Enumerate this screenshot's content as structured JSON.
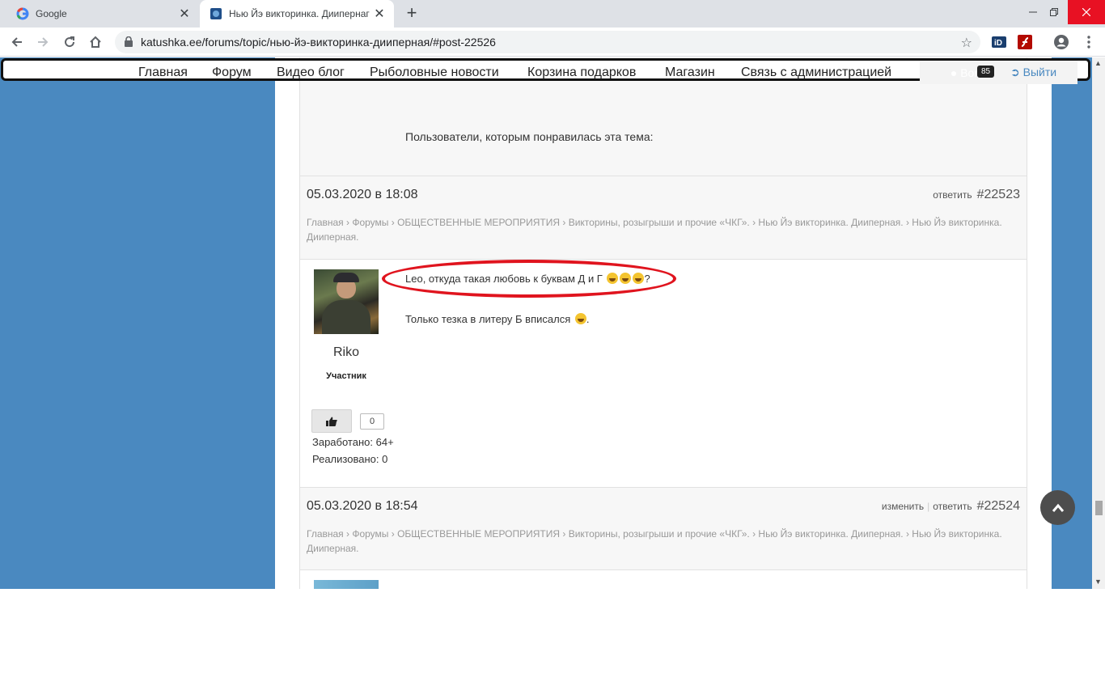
{
  "browser": {
    "tabs": [
      {
        "title": "Google",
        "icon": "google-g-icon"
      },
      {
        "title": "Нью Йэ викторинка. Диипернаг",
        "icon": "site-favicon"
      }
    ],
    "url": "katushka.ee/forums/topic/нью-йэ-викторинка-дииперная/#post-22526",
    "new_tab_symbol": "+",
    "close_symbol": "✕"
  },
  "nav": {
    "items": [
      "Главная",
      "Форум",
      "Видео блог",
      "Рыболовные новости",
      "Корзина подарков",
      "Магазин",
      "Связь с администрацией"
    ],
    "user": "Boris",
    "badge": "85",
    "logout": "Выйти"
  },
  "likes_section": {
    "text": "Пользователи, которым понравилась эта тема:"
  },
  "posts": [
    {
      "date": "05.03.2020 в 18:08",
      "actions": [
        "ответить"
      ],
      "number": "#22523",
      "breadcrumb": "Главная › Форумы › ОБЩЕСТВЕННЫЕ МЕРОПРИЯТИЯ › Викторины, розыгрыши и прочие «ЧКГ». › Нью Йэ викторинка. Дииперная. › Нью Йэ викторинка. Дииперная.",
      "author": "Riko",
      "role": "Участник",
      "message_line1": "Leo, откуда такая любовь к буквам Д и Г",
      "message_line1_end": "?",
      "message_line2": "Только тезка в литеру Б вписался",
      "message_line2_end": ".",
      "like_count": "0",
      "earned": "Заработано: 64+",
      "realized": "Реализовано: 0"
    },
    {
      "date": "05.03.2020 в 18:54",
      "actions": [
        "изменить",
        "ответить"
      ],
      "number": "#22524",
      "breadcrumb": "Главная › Форумы › ОБЩЕСТВЕННЫЕ МЕРОПРИЯТИЯ › Викторины, розыгрыши и прочие «ЧКГ». › Нью Йэ викторинка. Дииперная. › Нью Йэ викторинка. Дииперная."
    }
  ],
  "colors": {
    "page_background": "#4a89c0",
    "annotation_circle": "#e0141e",
    "link": "#4a89c0"
  }
}
